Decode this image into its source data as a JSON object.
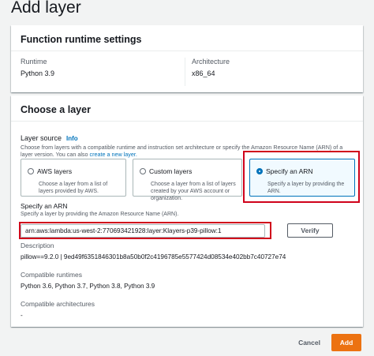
{
  "page": {
    "title": "Add layer"
  },
  "runtime_settings": {
    "header": "Function runtime settings",
    "runtime_label": "Runtime",
    "runtime_value": "Python 3.9",
    "architecture_label": "Architecture",
    "architecture_value": "x86_64"
  },
  "choose_layer": {
    "header": "Choose a layer",
    "source_label": "Layer source",
    "info_link": "Info",
    "source_desc": "Choose from layers with a compatible runtime and instruction set architecture or specify the Amazon Resource Name (ARN) of a layer version. You can also",
    "create_link": "create a new layer.",
    "tiles": [
      {
        "title": "AWS layers",
        "desc": "Choose a layer from a list of layers provided by AWS.",
        "selected": false
      },
      {
        "title": "Custom layers",
        "desc": "Choose a layer from a list of layers created by your AWS account or organization.",
        "selected": false
      },
      {
        "title": "Specify an ARN",
        "desc": "Specify a layer by providing the ARN.",
        "selected": true
      }
    ],
    "arn_label": "Specify an ARN",
    "arn_sub": "Specify a layer by providing the Amazon Resource Name (ARN).",
    "arn_value": "arn:aws:lambda:us-west-2:770693421928:layer:Klayers-p39-pillow:1",
    "verify_label": "Verify",
    "description_label": "Description",
    "description_value": "pillow==9.2.0 | 9ed49f6351846301b8a50b0f2c4196785e5577424d08534e402bb7c40727e74",
    "runtimes_label": "Compatible runtimes",
    "runtimes_value": "Python 3.6, Python 3.7, Python 3.8, Python 3.9",
    "arch_label": "Compatible architectures",
    "arch_value": "-"
  },
  "footer": {
    "cancel_label": "Cancel",
    "add_label": "Add"
  },
  "colors": {
    "accent": "#0073bb",
    "primary_button": "#ec7211",
    "highlight": "#d0021b"
  }
}
